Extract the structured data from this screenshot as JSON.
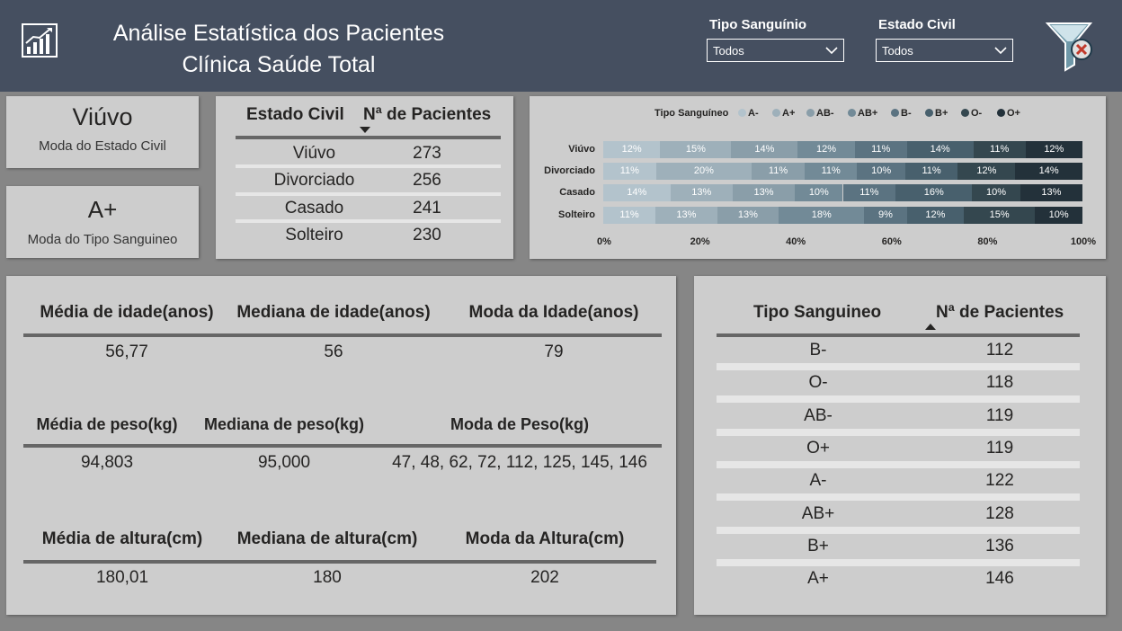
{
  "header": {
    "title_line1": "Análise Estatística dos Pacientes",
    "title_line2": "Clínica Saúde Total",
    "logo_icon": "bar-chart-icon",
    "filter_icon": "clear-filter-icon",
    "bg_color": "#454f60"
  },
  "slicers": {
    "blood_type": {
      "label": "Tipo Sanguínio",
      "value": "Todos"
    },
    "civil_status": {
      "label": "Estado Civil",
      "value": "Todos"
    }
  },
  "kpis": {
    "civil_mode": {
      "value": "Viúvo",
      "label": "Moda do Estado Civil"
    },
    "blood_mode": {
      "value": "A+",
      "label": "Moda do Tipo Sanguineo"
    }
  },
  "civil_table": {
    "headers": [
      "Estado Civil",
      "Nª de Pacientes"
    ],
    "rows": [
      [
        "Viúvo",
        "273"
      ],
      [
        "Divorciado",
        "256"
      ],
      [
        "Casado",
        "241"
      ],
      [
        "Solteiro",
        "230"
      ]
    ]
  },
  "chart_data": {
    "type": "bar",
    "orientation": "horizontal",
    "stacked": "100%",
    "legend_title": "Tipo Sanguíneo",
    "legend_position": "top",
    "categories": [
      "Viúvo",
      "Divorciado",
      "Casado",
      "Solteiro"
    ],
    "series": [
      {
        "name": "A-",
        "color": "#b3c3cc",
        "values": [
          12,
          11,
          14,
          11
        ]
      },
      {
        "name": "A+",
        "color": "#9eb0ba",
        "values": [
          15,
          20,
          13,
          13
        ]
      },
      {
        "name": "AB-",
        "color": "#8a9ea9",
        "values": [
          14,
          11,
          13,
          13
        ]
      },
      {
        "name": "AB+",
        "color": "#728a97",
        "values": [
          12,
          11,
          10,
          18
        ]
      },
      {
        "name": "B-",
        "color": "#5b7381",
        "values": [
          11,
          10,
          11,
          9
        ]
      },
      {
        "name": "B+",
        "color": "#48606d",
        "values": [
          14,
          11,
          16,
          12
        ]
      },
      {
        "name": "O-",
        "color": "#34474f",
        "values": [
          11,
          12,
          10,
          15
        ]
      },
      {
        "name": "O+",
        "color": "#23313a",
        "values": [
          12,
          14,
          13,
          10
        ]
      }
    ],
    "x_ticks": [
      "0%",
      "20%",
      "40%",
      "60%",
      "80%",
      "100%"
    ],
    "xlim": [
      0,
      100
    ]
  },
  "stats": {
    "rows": [
      {
        "headers": [
          "Média de idade(anos)",
          "Mediana de idade(anos)",
          "Moda da Idade(anos)"
        ],
        "values": [
          "56,77",
          "56",
          "79"
        ]
      },
      {
        "headers": [
          "Média de peso(kg)",
          "Mediana de peso(kg)",
          "Moda de Peso(kg)"
        ],
        "values": [
          "94,803",
          "95,000",
          "47, 48, 62, 72, 112, 125, 145, 146"
        ]
      },
      {
        "headers": [
          "Média de altura(cm)",
          "Mediana de altura(cm)",
          "Moda da Altura(cm)"
        ],
        "values": [
          "180,01",
          "180",
          "202"
        ]
      }
    ]
  },
  "blood_table": {
    "headers": [
      "Tipo Sanguineo",
      "Nª de Pacientes"
    ],
    "rows": [
      [
        "B-",
        "112"
      ],
      [
        "O-",
        "118"
      ],
      [
        "AB-",
        "119"
      ],
      [
        "O+",
        "119"
      ],
      [
        "A-",
        "122"
      ],
      [
        "AB+",
        "128"
      ],
      [
        "B+",
        "136"
      ],
      [
        "A+",
        "146"
      ]
    ]
  }
}
